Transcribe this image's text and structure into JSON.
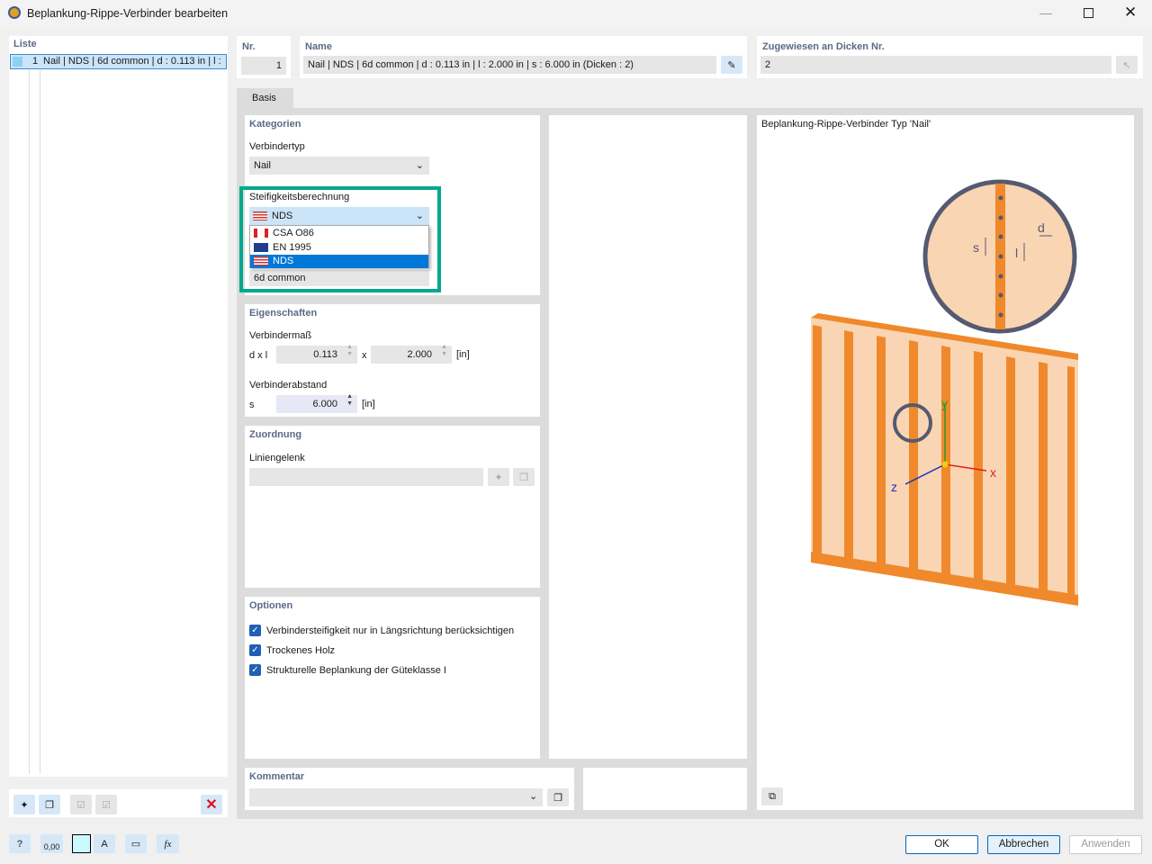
{
  "window": {
    "title": "Beplankung-Rippe-Verbinder bearbeiten"
  },
  "list": {
    "header": "Liste",
    "items": [
      {
        "nr": "1",
        "label": "Nail | NDS | 6d common | d : 0.113 in | l :"
      }
    ]
  },
  "nr": {
    "label": "Nr.",
    "value": "1"
  },
  "name": {
    "label": "Name",
    "value": "Nail | NDS | 6d common | d : 0.113 in | l : 2.000 in | s : 6.000 in (Dicken : 2)"
  },
  "assigned": {
    "label": "Zugewiesen an Dicken Nr.",
    "value": "2"
  },
  "tabs": [
    {
      "label": "Basis"
    }
  ],
  "kategorien": {
    "header": "Kategorien",
    "verbindertyp_label": "Verbindertyp",
    "verbindertyp_value": "Nail",
    "steif_label": "Steifigkeitsberechnung",
    "steif_value": "NDS",
    "options": [
      {
        "label": "CSA O86",
        "flag": "canada"
      },
      {
        "label": "EN 1995",
        "flag": "eu"
      },
      {
        "label": "NDS",
        "flag": "usa"
      }
    ],
    "hidden_value": "6d common"
  },
  "eigenschaften": {
    "header": "Eigenschaften",
    "mass_label": "Verbindermaß",
    "dxl_label": "d x l",
    "d": "0.113",
    "x_label": "x",
    "l": "2.000",
    "unit": "[in]",
    "abstand_label": "Verbinderabstand",
    "s_label": "s",
    "s": "6.000"
  },
  "zuordnung": {
    "header": "Zuordnung",
    "liniengelenk_label": "Liniengelenk",
    "liniengelenk_value": ""
  },
  "optionen": {
    "header": "Optionen",
    "items": [
      {
        "label": "Verbindersteifigkeit nur in Längsrichtung berücksichtigen",
        "checked": true
      },
      {
        "label": "Trockenes Holz",
        "checked": true
      },
      {
        "label": "Strukturelle Beplankung der Güteklasse I",
        "checked": true
      }
    ]
  },
  "kommentar": {
    "header": "Kommentar",
    "value": ""
  },
  "preview": {
    "title": "Beplankung-Rippe-Verbinder Typ 'Nail'",
    "axes": {
      "x": "x",
      "y": "y",
      "z": "z"
    },
    "dims": {
      "s": "s",
      "d": "d",
      "l": "l"
    }
  },
  "footer": {
    "ok": "OK",
    "cancel": "Abbrechen",
    "apply": "Anwenden",
    "decimal_icon_text": "0,00"
  },
  "colors": {
    "accent_highlight": "#00a88e",
    "selection": "#0078d7",
    "wood": "#f0892c",
    "wood_light": "#f9d5b3"
  }
}
